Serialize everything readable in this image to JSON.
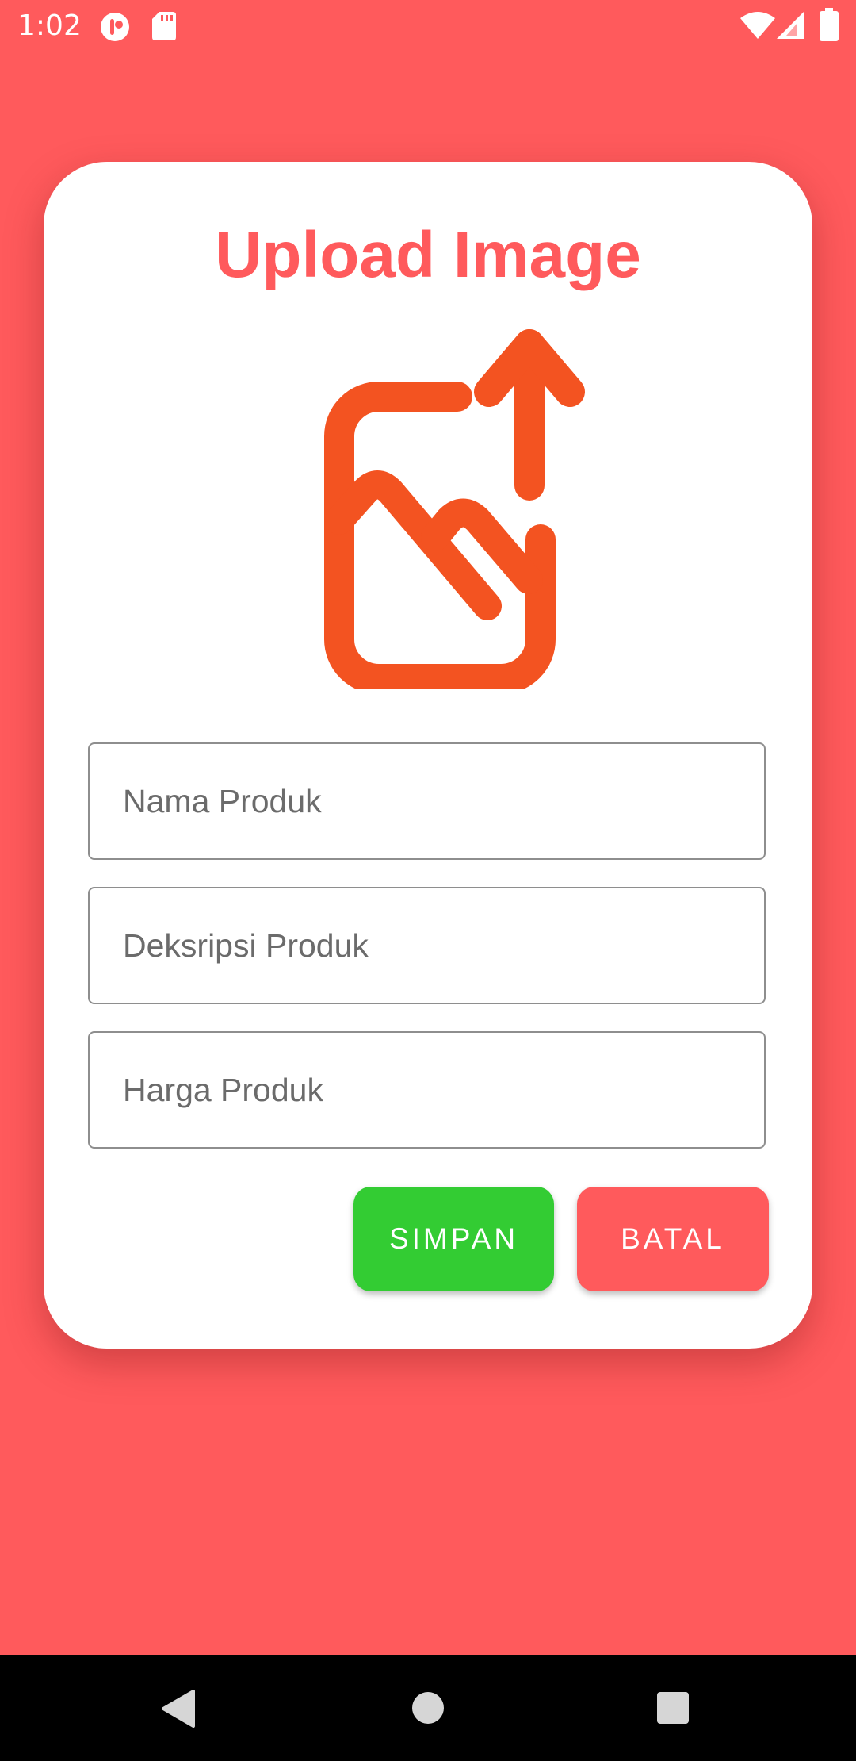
{
  "status_bar": {
    "time": "1:02",
    "icons": [
      "notification-app-icon",
      "sd-card-icon",
      "wifi-icon",
      "cellular-signal-icon",
      "battery-icon"
    ]
  },
  "card": {
    "title": "Upload Image",
    "graphic_icon": "image-upload-icon",
    "graphic_color": "#F35321",
    "fields": [
      {
        "placeholder": "Nama Produk",
        "value": ""
      },
      {
        "placeholder": "Deksripsi Produk",
        "value": ""
      },
      {
        "placeholder": "Harga Produk",
        "value": ""
      }
    ],
    "buttons": {
      "save_label": "SIMPAN",
      "cancel_label": "BATAL"
    }
  },
  "navigation_bar": {
    "buttons": [
      "back-icon",
      "home-icon",
      "recents-icon"
    ]
  },
  "colors": {
    "background": "#FF5A5C",
    "title": "#FF5A5C",
    "save_button": "#33CC33",
    "cancel_button": "#FF5A5C",
    "icon": "#F35321"
  }
}
